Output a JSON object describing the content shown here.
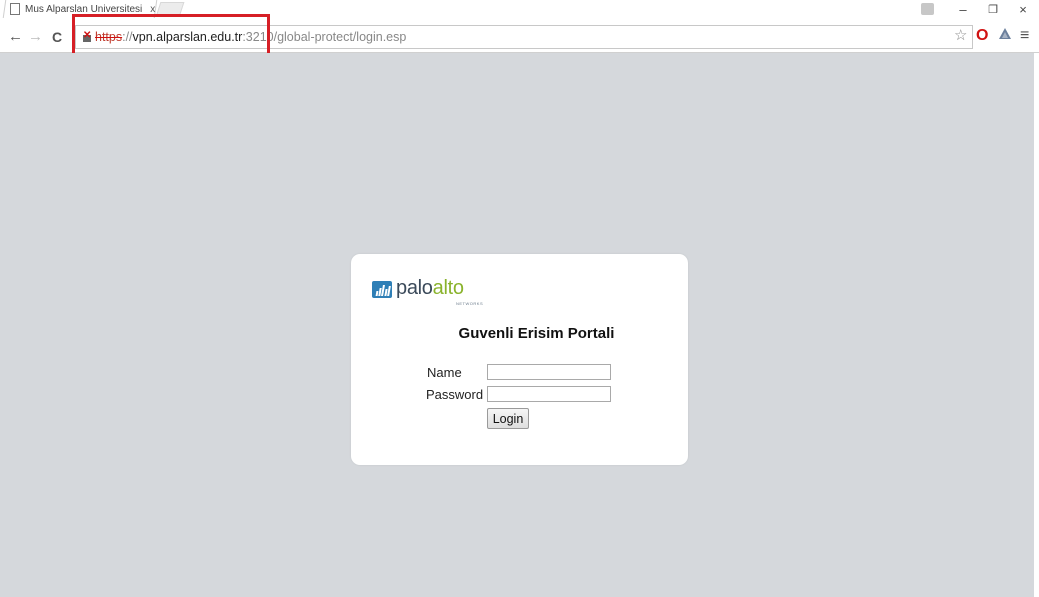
{
  "browser": {
    "tab_title": "Mus Alparslan Universitesi",
    "tab_close": "x",
    "url_scheme": "https",
    "url_sep": "://",
    "url_host": "vpn.alparslan.edu.tr",
    "url_rest": ":3210/global-protect/login.esp",
    "icons": {
      "back": "←",
      "forward": "→",
      "reload": "C",
      "star": "☆",
      "opera": "O",
      "menu": "≡",
      "minimize": "–",
      "maximize": "❐",
      "close": "×"
    }
  },
  "annotation": {
    "color": "#d61f26"
  },
  "login": {
    "logo_palo": "palo",
    "logo_alto": "alto",
    "logo_sub": "NETWORKS",
    "title": "Guvenli Erisim Portali",
    "name_label": "Name",
    "password_label": "Password",
    "name_value": "",
    "password_value": "",
    "login_button": "Login"
  },
  "colors": {
    "page_background": "#d5d8dc",
    "card_background": "#ffffff",
    "logo_blue": "#2f7fb6",
    "logo_green": "#8ab32c"
  }
}
